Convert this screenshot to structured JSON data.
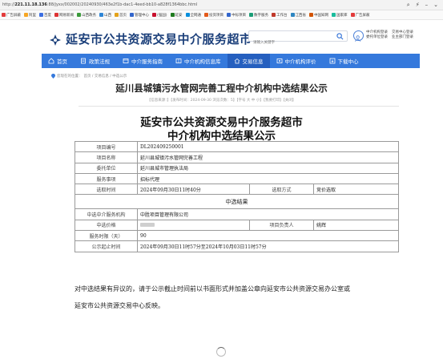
{
  "browser": {
    "url_prefix": "http://",
    "url_host": "221.11.18.136",
    "url_path": ":88/jyxx/002002/20240930/463e2f1b-dac1-4eed-bb10-a828f1364bbc.html",
    "bookmarks": [
      {
        "label": "广告屏蔽",
        "color": "#e23b3b"
      },
      {
        "label": "阿里",
        "color": "#f6a623"
      },
      {
        "label": "百度",
        "color": "#3b6ee2"
      },
      {
        "label": "网易新闻",
        "color": "#d33"
      },
      {
        "label": "山西政务",
        "color": "#3a9a3a"
      },
      {
        "label": "山西",
        "color": "#2f86d6"
      },
      {
        "label": "首页",
        "color": "#e3a21a"
      },
      {
        "label": "管理中心",
        "color": "#3366cc"
      },
      {
        "label": "(强国)",
        "color": "#c8102e"
      },
      {
        "label": "延安",
        "color": "#1f7a1f"
      },
      {
        "label": "全网通",
        "color": "#0a8fdc"
      },
      {
        "label": "投资项目",
        "color": "#e35a1a"
      },
      {
        "label": "中标项目",
        "color": "#36c"
      },
      {
        "label": "数字服务",
        "color": "#1b9e77"
      },
      {
        "label": "工作台",
        "color": "#c0392b"
      },
      {
        "label": "江西省",
        "color": "#2e86c1"
      },
      {
        "label": "中国知网",
        "color": "#d35400"
      },
      {
        "label": "国家库",
        "color": "#1abc9c"
      },
      {
        "label": "广告屏蔽",
        "color": "#e23b3b"
      }
    ]
  },
  "header": {
    "site_name": "延安市公共资源交易中介服务超市",
    "search_placeholder": "请输入关键字",
    "links": [
      "中介机构登录",
      "交易中心登录",
      "委托单位登录",
      "业主部门登录"
    ]
  },
  "nav": {
    "items": [
      {
        "label": "首页",
        "icon": "home-icon",
        "active": false
      },
      {
        "label": "政策法规",
        "icon": "document-icon",
        "active": false
      },
      {
        "label": "中介服务指南",
        "icon": "guide-icon",
        "active": false
      },
      {
        "label": "中介机构信息库",
        "icon": "database-icon",
        "active": false
      },
      {
        "label": "交易信息",
        "icon": "trade-icon",
        "active": true
      },
      {
        "label": "中介机构评价",
        "icon": "rating-icon",
        "active": false
      },
      {
        "label": "下载中心",
        "icon": "download-icon",
        "active": false
      }
    ]
  },
  "breadcrumb": {
    "prefix": "您现在的位置：",
    "trail": "首页 / 交易信息 / 中选公示"
  },
  "article": {
    "title": "延川县城镇污水管网完善工程中介机构中选结果公示",
    "meta": "【信息来源：】【发布时间：2024-09-30  浏览次数：5】【字号 大 中 小】【我要打印】【关闭】",
    "heading_line1": "延安市公共资源交易中介服务超市",
    "heading_line2": "中介机构中选结果公示"
  },
  "table": {
    "project_no_label": "项目编号",
    "project_no": "DL202409250001",
    "project_name_label": "项目名称",
    "project_name": "延川县城镇污水管网完善工程",
    "client_label": "委托单位",
    "client": "延川县城市管理执法局",
    "service_label": "服务事项",
    "service": "招标代理",
    "select_time_label": "选取时间",
    "select_time": "2024年09月30日11时40分",
    "select_method_label": "选取方式",
    "select_method": "竞价选取",
    "result_section": "中选结果",
    "agency_label": "中选中介服务机构",
    "agency": "中胜项目管理有限公司",
    "price_label": "中选价格",
    "price": "",
    "leader_label": "项目负责人",
    "leader": "姚辉",
    "duration_label": "服务时限（天）",
    "duration": "90",
    "period_label": "公示起止时间",
    "period": "2024年09月30日11时57分至2024年10月03日11时57分"
  },
  "notice": {
    "line1": "对中选结果有异议的，请于公示截止时间前以书面形式并加盖公章向延安市公共资源交易办公室或",
    "line2": "延安市公共资源交易中心反映。"
  }
}
